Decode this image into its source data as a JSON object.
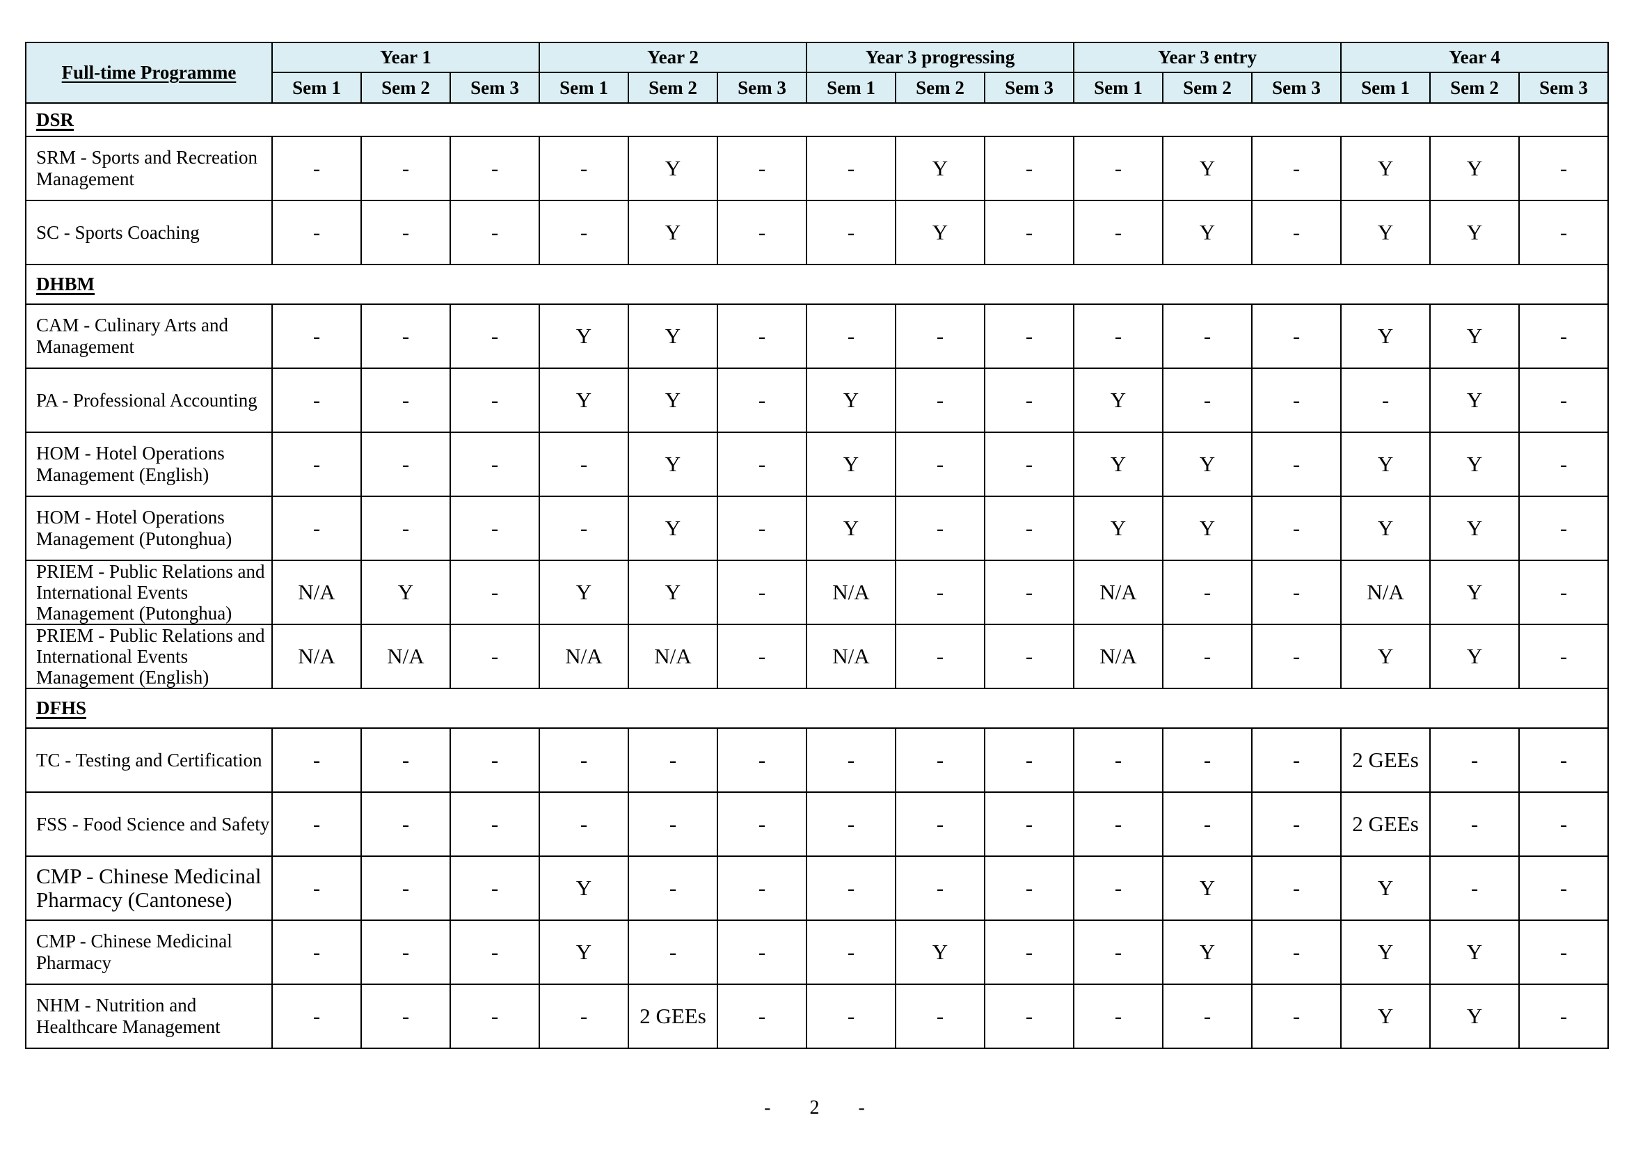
{
  "header": {
    "programme_label": "Full-time Programme",
    "years": [
      "Year 1",
      "Year 2",
      "Year 3 progressing",
      "Year 3 entry",
      "Year 4"
    ],
    "sems": [
      "Sem 1",
      "Sem 2",
      "Sem 3"
    ]
  },
  "sections": [
    {
      "dept": "DSR",
      "rows": [
        {
          "name": "SRM - Sports and Recreation Management",
          "values": [
            "-",
            "-",
            "-",
            "-",
            "Y",
            "-",
            "-",
            "Y",
            "-",
            "-",
            "Y",
            "-",
            "Y",
            "Y",
            "-"
          ]
        },
        {
          "name": "SC - Sports Coaching",
          "values": [
            "-",
            "-",
            "-",
            "-",
            "Y",
            "-",
            "-",
            "Y",
            "-",
            "-",
            "Y",
            "-",
            "Y",
            "Y",
            "-"
          ]
        }
      ]
    },
    {
      "dept": "DHBM",
      "rows": [
        {
          "name": "CAM - Culinary Arts and Management",
          "values": [
            "-",
            "-",
            "-",
            "Y",
            "Y",
            "-",
            "-",
            "-",
            "-",
            "-",
            "-",
            "-",
            "Y",
            "Y",
            "-"
          ]
        },
        {
          "name": "PA - Professional Accounting",
          "values": [
            "-",
            "-",
            "-",
            "Y",
            "Y",
            "-",
            "Y",
            "-",
            "-",
            "Y",
            "-",
            "-",
            "-",
            "Y",
            "-"
          ]
        },
        {
          "name": "HOM - Hotel Operations Management (English)",
          "values": [
            "-",
            "-",
            "-",
            "-",
            "Y",
            "-",
            "Y",
            "-",
            "-",
            "Y",
            "Y",
            "-",
            "Y",
            "Y",
            "-"
          ]
        },
        {
          "name": "HOM - Hotel Operations Management (Putonghua)",
          "values": [
            "-",
            "-",
            "-",
            "-",
            "Y",
            "-",
            "Y",
            "-",
            "-",
            "Y",
            "Y",
            "-",
            "Y",
            "Y",
            "-"
          ]
        },
        {
          "name": "PRIEM - Public Relations and International Events Management (Putonghua)",
          "values": [
            "N/A",
            "Y",
            "-",
            "Y",
            "Y",
            "-",
            "N/A",
            "-",
            "-",
            "N/A",
            "-",
            "-",
            "N/A",
            "Y",
            "-"
          ]
        },
        {
          "name": "PRIEM - Public Relations and International Events Management (English)",
          "values": [
            "N/A",
            "N/A",
            "-",
            "N/A",
            "N/A",
            "-",
            "N/A",
            "-",
            "-",
            "N/A",
            "-",
            "-",
            "Y",
            "Y",
            "-"
          ]
        }
      ]
    },
    {
      "dept": "DFHS",
      "rows": [
        {
          "name": "TC - Testing and Certification",
          "values": [
            "-",
            "-",
            "-",
            "-",
            "-",
            "-",
            "-",
            "-",
            "-",
            "-",
            "-",
            "-",
            "2 GEEs",
            "-",
            "-"
          ]
        },
        {
          "name": "FSS - Food Science and Safety",
          "values": [
            "-",
            "-",
            "-",
            "-",
            "-",
            "-",
            "-",
            "-",
            "-",
            "-",
            "-",
            "-",
            "2 GEEs",
            "-",
            "-"
          ]
        },
        {
          "name": "CMP - Chinese Medicinal Pharmacy (Cantonese)",
          "values": [
            "-",
            "-",
            "-",
            "Y",
            "-",
            "-",
            "-",
            "-",
            "-",
            "-",
            "Y",
            "-",
            "Y",
            "-",
            "-"
          ]
        },
        {
          "name": "CMP - Chinese Medicinal Pharmacy",
          "values": [
            "-",
            "-",
            "-",
            "Y",
            "-",
            "-",
            "-",
            "Y",
            "-",
            "-",
            "Y",
            "-",
            "Y",
            "Y",
            "-"
          ]
        },
        {
          "name": "NHM - Nutrition and Healthcare Management",
          "values": [
            "-",
            "-",
            "-",
            "-",
            "2 GEEs",
            "-",
            "-",
            "-",
            "-",
            "-",
            "-",
            "-",
            "Y",
            "Y",
            "-"
          ]
        }
      ]
    }
  ],
  "footer": {
    "dash_left": "-",
    "page_number": "2",
    "dash_right": "-"
  },
  "colors": {
    "header_bg": "#DAEEF3",
    "border": "#000000"
  }
}
